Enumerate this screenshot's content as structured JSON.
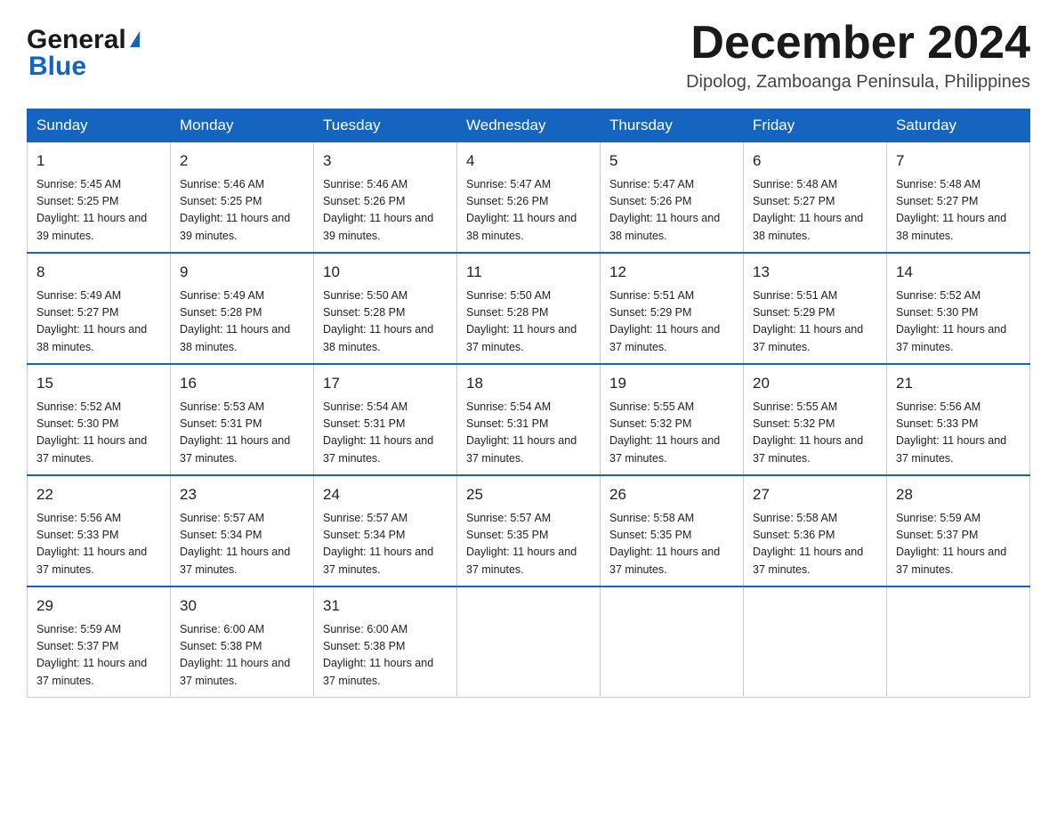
{
  "header": {
    "logo_general": "General",
    "logo_triangle": "▶",
    "logo_blue": "Blue",
    "month_title": "December 2024",
    "location": "Dipolog, Zamboanga Peninsula, Philippines"
  },
  "weekdays": [
    "Sunday",
    "Monday",
    "Tuesday",
    "Wednesday",
    "Thursday",
    "Friday",
    "Saturday"
  ],
  "weeks": [
    [
      {
        "day": "1",
        "sunrise": "5:45 AM",
        "sunset": "5:25 PM",
        "daylight": "11 hours and 39 minutes."
      },
      {
        "day": "2",
        "sunrise": "5:46 AM",
        "sunset": "5:25 PM",
        "daylight": "11 hours and 39 minutes."
      },
      {
        "day": "3",
        "sunrise": "5:46 AM",
        "sunset": "5:26 PM",
        "daylight": "11 hours and 39 minutes."
      },
      {
        "day": "4",
        "sunrise": "5:47 AM",
        "sunset": "5:26 PM",
        "daylight": "11 hours and 38 minutes."
      },
      {
        "day": "5",
        "sunrise": "5:47 AM",
        "sunset": "5:26 PM",
        "daylight": "11 hours and 38 minutes."
      },
      {
        "day": "6",
        "sunrise": "5:48 AM",
        "sunset": "5:27 PM",
        "daylight": "11 hours and 38 minutes."
      },
      {
        "day": "7",
        "sunrise": "5:48 AM",
        "sunset": "5:27 PM",
        "daylight": "11 hours and 38 minutes."
      }
    ],
    [
      {
        "day": "8",
        "sunrise": "5:49 AM",
        "sunset": "5:27 PM",
        "daylight": "11 hours and 38 minutes."
      },
      {
        "day": "9",
        "sunrise": "5:49 AM",
        "sunset": "5:28 PM",
        "daylight": "11 hours and 38 minutes."
      },
      {
        "day": "10",
        "sunrise": "5:50 AM",
        "sunset": "5:28 PM",
        "daylight": "11 hours and 38 minutes."
      },
      {
        "day": "11",
        "sunrise": "5:50 AM",
        "sunset": "5:28 PM",
        "daylight": "11 hours and 37 minutes."
      },
      {
        "day": "12",
        "sunrise": "5:51 AM",
        "sunset": "5:29 PM",
        "daylight": "11 hours and 37 minutes."
      },
      {
        "day": "13",
        "sunrise": "5:51 AM",
        "sunset": "5:29 PM",
        "daylight": "11 hours and 37 minutes."
      },
      {
        "day": "14",
        "sunrise": "5:52 AM",
        "sunset": "5:30 PM",
        "daylight": "11 hours and 37 minutes."
      }
    ],
    [
      {
        "day": "15",
        "sunrise": "5:52 AM",
        "sunset": "5:30 PM",
        "daylight": "11 hours and 37 minutes."
      },
      {
        "day": "16",
        "sunrise": "5:53 AM",
        "sunset": "5:31 PM",
        "daylight": "11 hours and 37 minutes."
      },
      {
        "day": "17",
        "sunrise": "5:54 AM",
        "sunset": "5:31 PM",
        "daylight": "11 hours and 37 minutes."
      },
      {
        "day": "18",
        "sunrise": "5:54 AM",
        "sunset": "5:31 PM",
        "daylight": "11 hours and 37 minutes."
      },
      {
        "day": "19",
        "sunrise": "5:55 AM",
        "sunset": "5:32 PM",
        "daylight": "11 hours and 37 minutes."
      },
      {
        "day": "20",
        "sunrise": "5:55 AM",
        "sunset": "5:32 PM",
        "daylight": "11 hours and 37 minutes."
      },
      {
        "day": "21",
        "sunrise": "5:56 AM",
        "sunset": "5:33 PM",
        "daylight": "11 hours and 37 minutes."
      }
    ],
    [
      {
        "day": "22",
        "sunrise": "5:56 AM",
        "sunset": "5:33 PM",
        "daylight": "11 hours and 37 minutes."
      },
      {
        "day": "23",
        "sunrise": "5:57 AM",
        "sunset": "5:34 PM",
        "daylight": "11 hours and 37 minutes."
      },
      {
        "day": "24",
        "sunrise": "5:57 AM",
        "sunset": "5:34 PM",
        "daylight": "11 hours and 37 minutes."
      },
      {
        "day": "25",
        "sunrise": "5:57 AM",
        "sunset": "5:35 PM",
        "daylight": "11 hours and 37 minutes."
      },
      {
        "day": "26",
        "sunrise": "5:58 AM",
        "sunset": "5:35 PM",
        "daylight": "11 hours and 37 minutes."
      },
      {
        "day": "27",
        "sunrise": "5:58 AM",
        "sunset": "5:36 PM",
        "daylight": "11 hours and 37 minutes."
      },
      {
        "day": "28",
        "sunrise": "5:59 AM",
        "sunset": "5:37 PM",
        "daylight": "11 hours and 37 minutes."
      }
    ],
    [
      {
        "day": "29",
        "sunrise": "5:59 AM",
        "sunset": "5:37 PM",
        "daylight": "11 hours and 37 minutes."
      },
      {
        "day": "30",
        "sunrise": "6:00 AM",
        "sunset": "5:38 PM",
        "daylight": "11 hours and 37 minutes."
      },
      {
        "day": "31",
        "sunrise": "6:00 AM",
        "sunset": "5:38 PM",
        "daylight": "11 hours and 37 minutes."
      },
      null,
      null,
      null,
      null
    ]
  ],
  "labels": {
    "sunrise_prefix": "Sunrise: ",
    "sunset_prefix": "Sunset: ",
    "daylight_prefix": "Daylight: "
  }
}
